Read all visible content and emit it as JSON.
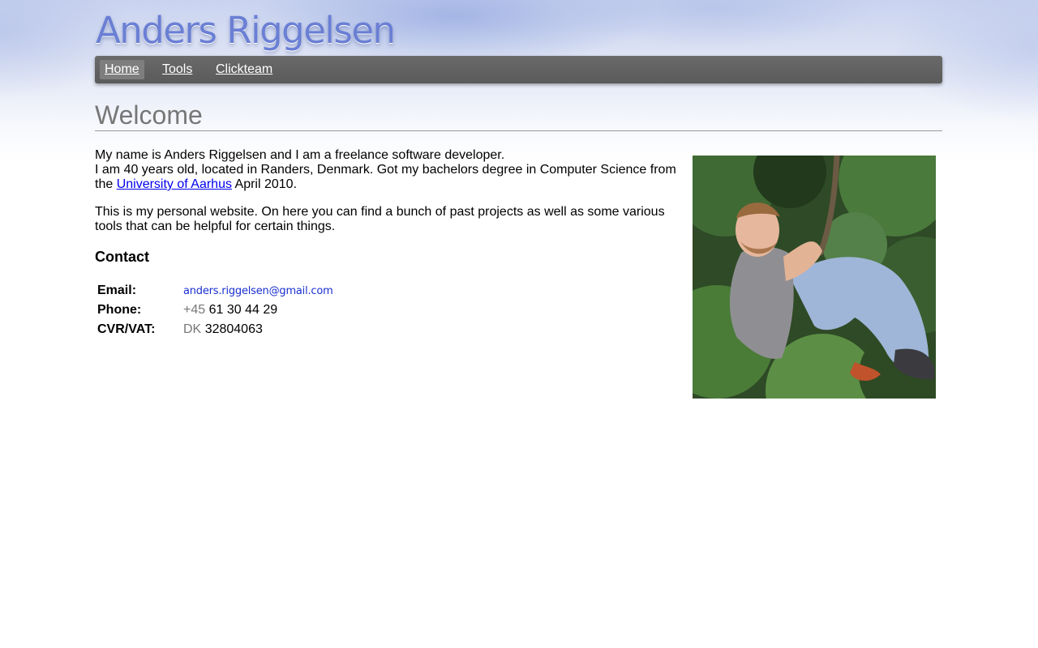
{
  "header": {
    "title": "Anders Riggelsen"
  },
  "nav": {
    "items": [
      {
        "label": "Home",
        "active": true
      },
      {
        "label": "Tools",
        "active": false
      },
      {
        "label": "Clickteam",
        "active": false
      }
    ]
  },
  "page": {
    "heading": "Welcome",
    "intro_line1": "My name is Anders Riggelsen and I am a freelance software developer.",
    "intro_line2_before": "I am 40 years old, located in Randers, Denmark. Got my bachelors degree in Computer Science from the ",
    "university_link": "University of Aarhus",
    "intro_line2_after": " April 2010.",
    "intro_para2": "This is my personal website. On here you can find a bunch of past projects as well as some various tools that can be helpful for certain things."
  },
  "contact": {
    "heading": "Contact",
    "email_label": "Email:",
    "email_value": "anders.riggelsen@gmail.com",
    "phone_label": "Phone:",
    "phone_prefix": "+45",
    "phone_number": "61 30 44 29",
    "vat_label": "CVR/VAT:",
    "vat_prefix": "DK",
    "vat_number": "32804063"
  },
  "colors": {
    "nav_bg": "#5f5f5f",
    "logo": "#6a7fd4",
    "heading": "#777777",
    "link": "#0000ee"
  }
}
